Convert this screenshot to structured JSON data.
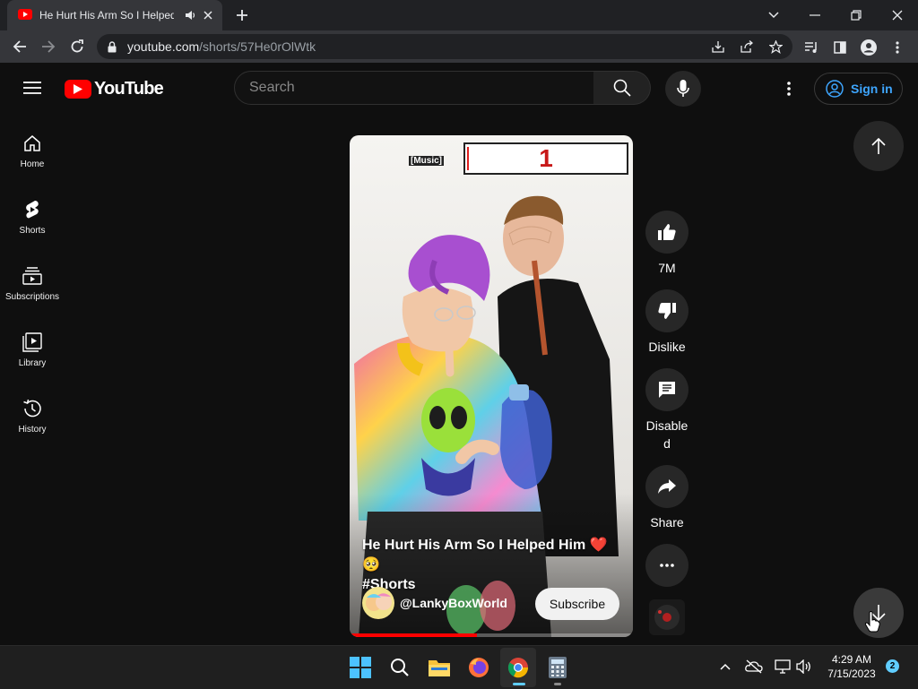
{
  "browser": {
    "tab_title": "He Hurt His Arm So I Helped",
    "url_host": "youtube.com",
    "url_path": "/shorts/57He0rOlWtk"
  },
  "youtube": {
    "logo_text": "YouTube",
    "search_placeholder": "Search",
    "sign_in": "Sign in",
    "sidebar": [
      {
        "label": "Home",
        "icon": "home-icon"
      },
      {
        "label": "Shorts",
        "icon": "shorts-icon"
      },
      {
        "label": "Subscriptions",
        "icon": "subscriptions-icon"
      },
      {
        "label": "Library",
        "icon": "library-icon"
      },
      {
        "label": "History",
        "icon": "history-icon"
      }
    ]
  },
  "short": {
    "caption_tag": "[Music]",
    "counter": "1",
    "title_line1": "He Hurt His Arm So I Helped Him ❤️ 🥺",
    "title_line2": "#Shorts",
    "channel": "@LankyBoxWorld",
    "subscribe": "Subscribe"
  },
  "actions": {
    "likes": "7M",
    "dislike": "Dislike",
    "comments_line1": "Disable",
    "comments_line2": "d",
    "share": "Share"
  },
  "taskbar": {
    "time": "4:29 AM",
    "date": "7/15/2023",
    "notifications": "2"
  },
  "colors": {
    "accent": "#3ea6ff",
    "youtube_red": "#ff0000",
    "background": "#0f0f0f"
  }
}
